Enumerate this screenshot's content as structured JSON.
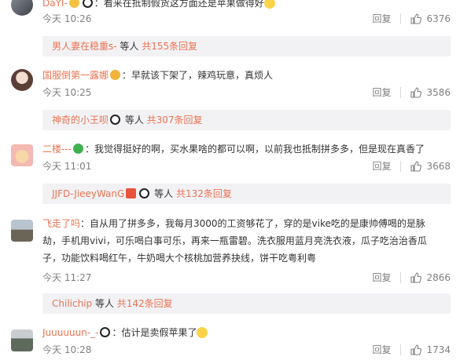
{
  "comments": [
    {
      "user": "DaYI-",
      "text": "：看来在抵制假货这方面还是苹果做得好",
      "time": "今天 10:26",
      "reply_label": "回复",
      "likes": "6376",
      "sub": {
        "name": "男人妻在稳重s-",
        "etc": " 等人 ",
        "count": "共155条回复"
      }
    },
    {
      "user": "国服倒第一露娜",
      "text": "：早就该下架了，辣鸡玩意，真烦人",
      "time": "今天 10:25",
      "reply_label": "回复",
      "likes": "3586",
      "sub": {
        "name": "神奇的小王呗",
        "etc": " 等人 ",
        "count": "共307条回复"
      }
    },
    {
      "user": "二楼---",
      "text": "：我觉得挺好的啊，买水果啥的都可以啊，以前我也抵制拼多多，但是现在真香了",
      "time": "今天 11:01",
      "reply_label": "回复",
      "likes": "3668",
      "sub": {
        "name": "JJFD-JieeyWanG",
        "etc": " 等人 ",
        "count": "共132条回复"
      }
    },
    {
      "user": "飞走了吗",
      "text": "：自从用了拼多多，我每月3000的工资够花了，穿的是vike吃的是康帅傅喝的是脉劫，手机用vivi，可乐喝白事可乐，再来一瓶雷碧。洗衣服用蓝月亮洗衣液，瓜子吃治治香瓜子，功能饮料喝红午，牛奶喝大个核桃加营养抉线，饼干吃粤利粤",
      "time": "今天 11:27",
      "reply_label": "回复",
      "likes": "2866",
      "sub": {
        "name": "Chilichip",
        "etc": " 等人 ",
        "count": "共142条回复"
      }
    },
    {
      "user": "Juuuuuun-_-",
      "text": "：估计是卖假苹果了",
      "time": "今天 10:28",
      "reply_label": "回复",
      "likes": "1734"
    }
  ],
  "colors": {
    "username": "#eb7350",
    "meta": "#808080",
    "sub_bg": "#f2f2f5"
  }
}
